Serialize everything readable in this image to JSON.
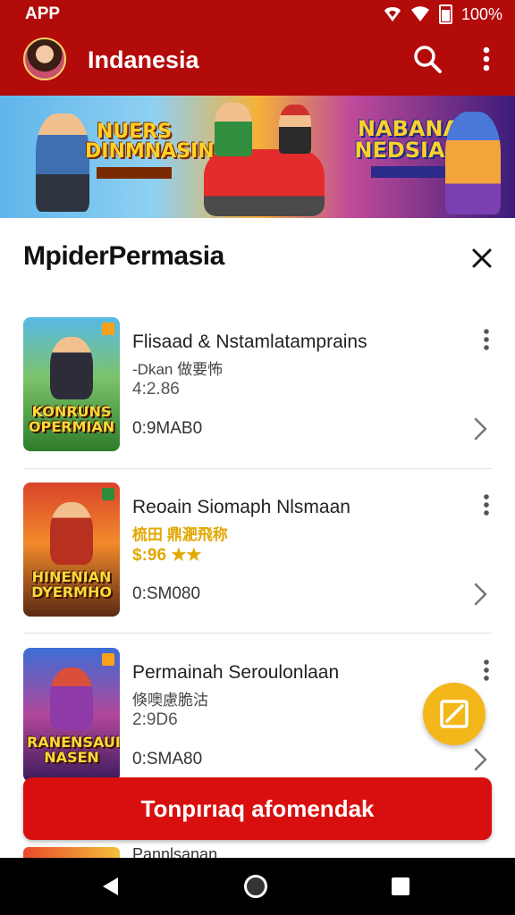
{
  "status_bar": {
    "app_label": "APP",
    "battery": "100%"
  },
  "app_bar": {
    "title": "Indanesia"
  },
  "banner": {
    "left_title": "NUERS DINMNASIN",
    "right_title": "NABANA NEDSIAN"
  },
  "section": {
    "title": "MpiderPermasia"
  },
  "items": [
    {
      "title": "Flisaad & Nstamlatamprains",
      "subtitle": "-Dkan 做要怖",
      "rating": "4:2.86",
      "size": "0:9MAB0",
      "thumb_label": "KONRUNS OPERMIAN"
    },
    {
      "title": "Reoain Siomaph Nlsmaan",
      "subtitle": "梳田 鼎淝飛称",
      "rating": "$:96",
      "stars": "★★",
      "size": "0:SM080",
      "thumb_label": "HINENIAN DYERMHO"
    },
    {
      "title": "Permainah Seroulonlaan",
      "subtitle": "倏噢慮脆沽",
      "rating": "2:9D6",
      "size": "0:SMA80",
      "thumb_label": "RANENSAUION NASEN"
    }
  ],
  "peek_item": {
    "title": "Pannlsanan"
  },
  "cta": {
    "label": "Tonpırıaq afomendak"
  },
  "colors": {
    "header": "#b30a0a",
    "cta": "#d90f0f",
    "fab": "#f3b71a",
    "accent_gold": "#e0a800"
  },
  "icons": [
    "avatar",
    "search-icon",
    "more-vert-icon",
    "close-icon",
    "chevron-right-icon",
    "edit-icon",
    "nav-back-icon",
    "nav-home-icon",
    "nav-recent-icon"
  ]
}
